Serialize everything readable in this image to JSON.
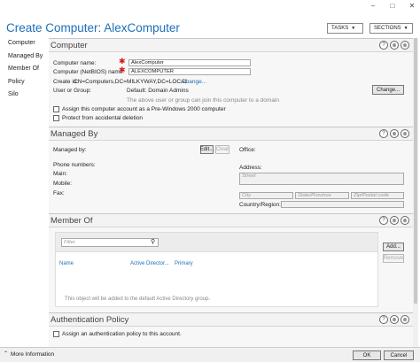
{
  "window": {
    "title": "Create Computer: AlexComputer",
    "controls": [
      "–",
      "□",
      "✕"
    ]
  },
  "toolbar": {
    "tasks_label": "TASKS",
    "sections_label": "SECTIONS"
  },
  "sidebar": {
    "items": [
      {
        "label": "Computer"
      },
      {
        "label": "Managed By"
      },
      {
        "label": "Member Of"
      },
      {
        "label": "Policy"
      },
      {
        "label": "Silo"
      }
    ]
  },
  "computer": {
    "heading": "Computer",
    "name_label": "Computer name:",
    "name_value": "AlexComputer",
    "netbios_label": "Computer (NetBIOS) name:",
    "netbios_value": "ALEXCOMPUTER",
    "create_in_label": "Create in:",
    "create_in_value": "CN=Computers,DC=MILKYWAY,DC=LOCAL",
    "change_link": "Change...",
    "user_group_label": "User or Group:",
    "default_value": "Default: Domain Admins",
    "change_button": "Change...",
    "note": "The above user or group can join this computer to a domain",
    "pre2000_label": "Assign this computer account as a Pre-Windows 2000 computer",
    "protect_label": "Protect from accidental deletion"
  },
  "managed_by": {
    "heading": "Managed By",
    "managed_label": "Managed by:",
    "edit_button": "Edit...",
    "clear_button": "Clear",
    "office_label": "Office:",
    "phone_label": "Phone numbers:",
    "main_label": "Main:",
    "mobile_label": "Mobile:",
    "fax_label": "Fax:",
    "address_label": "Address:",
    "street_placeholder": "Street",
    "city_placeholder": "City",
    "state_placeholder": "State/Province",
    "zip_placeholder": "Zip/Postal code",
    "country_label": "Country/Region:"
  },
  "member_of": {
    "heading": "Member Of",
    "filter_placeholder": "Filter",
    "columns": [
      "Name",
      "Active Director...",
      "Primary"
    ],
    "add_button": "Add...",
    "remove_button": "Remove",
    "note": "This object will be added to the default Active Directory group."
  },
  "policy": {
    "heading": "Authentication Policy",
    "assign_label": "Assign an authentication policy to this account."
  },
  "footer": {
    "more_info": "More Information",
    "ok": "OK",
    "cancel": "Cancel"
  },
  "head_icons": {
    "help": "?",
    "collapse": "⊗",
    "expand": "⊗"
  }
}
